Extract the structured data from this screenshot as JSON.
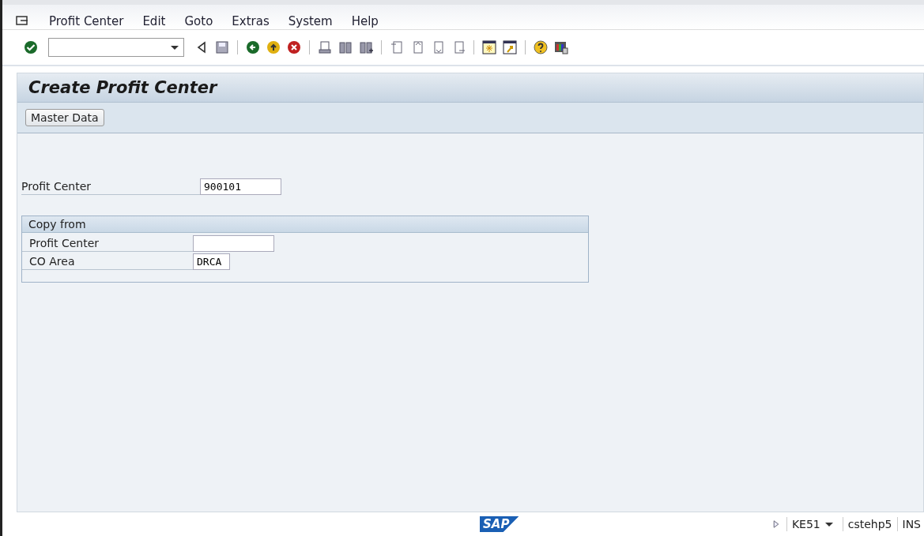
{
  "menu_bar": [
    "Profit Center",
    "Edit",
    "Goto",
    "Extras",
    "System",
    "Help"
  ],
  "screen": {
    "title": "Create Profit Center",
    "app_toolbar": [
      "Master Data"
    ],
    "fields": [
      {
        "label": "Profit Center",
        "value": "900101"
      }
    ],
    "copy_from": {
      "title": "Copy from",
      "fields": [
        {
          "label": "Profit Center"
        },
        {
          "label": "CO Area",
          "value": "DRCA"
        }
      ]
    }
  },
  "status_bar": {
    "logo": "SAP",
    "transaction": "KE51",
    "server": "cstehp5",
    "mode": "INS"
  }
}
